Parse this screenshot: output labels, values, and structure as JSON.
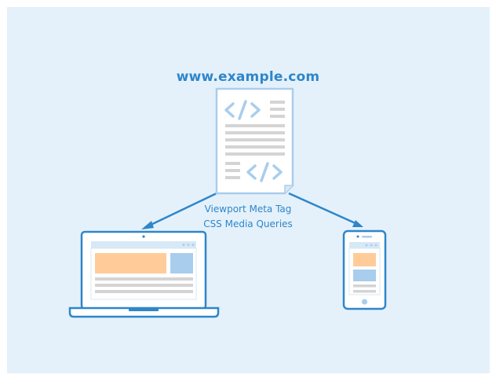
{
  "site_url": "www.example.com",
  "techniques": [
    "Viewport Meta Tag",
    "CSS Media Queries"
  ],
  "colors": {
    "background": "#e4f1fb",
    "accent": "#2f86c8",
    "page_fill": "#ffffff",
    "code_glyph": "#a9cdec",
    "text_lines": "#d4d4d4",
    "orange_block": "#ffcc99",
    "blue_block": "#a9cdec"
  },
  "icons": [
    "code-document-icon",
    "laptop-icon",
    "smartphone-icon"
  ]
}
